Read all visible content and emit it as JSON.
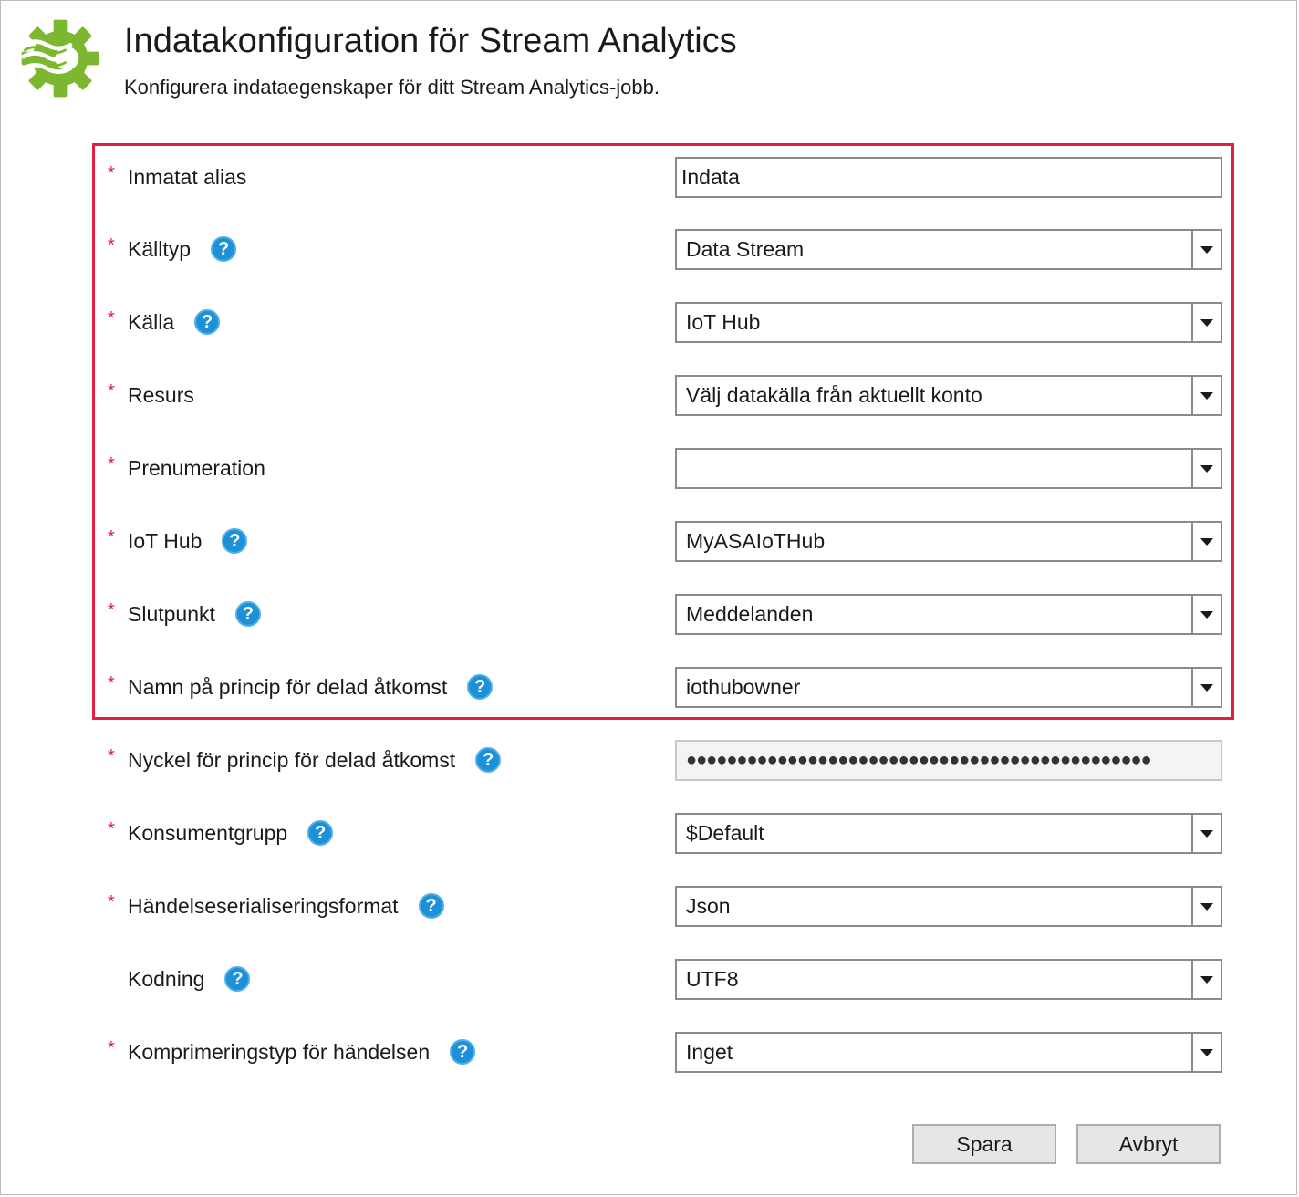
{
  "header": {
    "title": "Indatakonfiguration för Stream Analytics",
    "subtitle": "Konfigurera indataegenskaper för ditt Stream Analytics-jobb.",
    "logo_icon": "stream-analytics-gear-icon",
    "logo_color": "#7cb82f"
  },
  "highlight_color": "#e0203c",
  "required_mark": "*",
  "help_glyph": "?",
  "fields": {
    "input_alias": {
      "label": "Inmatat alias",
      "value": "Indata"
    },
    "source_type": {
      "label": "Källtyp",
      "value": "Data Stream"
    },
    "source": {
      "label": "Källa",
      "value": "IoT Hub"
    },
    "resource": {
      "label": "Resurs",
      "value": "Välj datakälla från aktuellt konto"
    },
    "subscription": {
      "label": "Prenumeration",
      "value": ""
    },
    "iot_hub": {
      "label": "IoT Hub",
      "value": "MyASAIoTHub"
    },
    "endpoint": {
      "label": "Slutpunkt",
      "value": "Meddelanden"
    },
    "shared_access_policy_name": {
      "label": "Namn på princip för delad åtkomst",
      "value": "iothubowner"
    },
    "shared_access_policy_key": {
      "label": "Nyckel för princip för delad åtkomst",
      "value": "●●●●●●●●●●●●●●●●●●●●●●●●●●●●●●●●●●●●●●●●●●●●●●"
    },
    "consumer_group": {
      "label": "Konsumentgrupp",
      "value": "$Default"
    },
    "serialization_format": {
      "label": "Händelseserialiseringsformat",
      "value": "Json"
    },
    "encoding": {
      "label": "Kodning",
      "value": "UTF8"
    },
    "compression_type": {
      "label": "Komprimeringstyp för händelsen",
      "value": "Inget"
    }
  },
  "buttons": {
    "save": "Spara",
    "cancel": "Avbryt"
  }
}
